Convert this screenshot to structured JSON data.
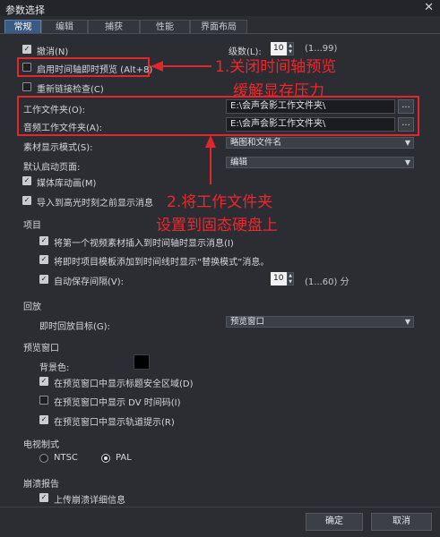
{
  "window": {
    "title": "参数选择"
  },
  "tabs": [
    {
      "label": "常规",
      "active": true
    },
    {
      "label": "编辑"
    },
    {
      "label": "捕获"
    },
    {
      "label": "性能"
    },
    {
      "label": "界面布局"
    }
  ],
  "general": {
    "undo": {
      "label": "撤消(N)",
      "checked": true
    },
    "levels": {
      "label": "级数(L):",
      "value": "10",
      "range": "(1...99)"
    },
    "instant_preview": {
      "label": "启用时间轴即时预览 (Alt+8)",
      "checked": false
    },
    "relink_check": {
      "label": "重新链接检查(C)",
      "checked": false
    },
    "work_folder": {
      "label": "工作文件夹(O):",
      "value": "E:\\会声会影工作文件夹\\",
      "browse": "..."
    },
    "audio_work_folder": {
      "label": "音频工作文件夹(A):",
      "value": "E:\\会声会影工作文件夹\\",
      "browse": "..."
    },
    "clip_display_mode": {
      "label": "素材显示模式(S):",
      "value": "略图和文件名"
    },
    "default_start_page": {
      "label": "默认启动页面:",
      "value": "编辑"
    },
    "media_library_animation": {
      "label": "媒体库动画(M)",
      "checked": true
    },
    "import_highlight": {
      "label": "导入到高光时刻之前显示消息",
      "checked": true
    }
  },
  "project": {
    "title": "项目",
    "first_clip_msg": {
      "label": "将第一个视频素材插入到时间轴时显示消息(I)",
      "checked": true
    },
    "replace_mode_msg": {
      "label": "将即时项目模板添加到时间线时显示“替换模式”消息。",
      "checked": true
    },
    "autosave": {
      "label": "自动保存间隔(V):",
      "checked": true,
      "value": "10",
      "range": "(1...60) 分"
    }
  },
  "playback": {
    "title": "回放",
    "target": {
      "label": "即时回放目标(G):",
      "value": "预览窗口"
    }
  },
  "preview_window": {
    "title": "预览窗口",
    "bg_color": {
      "label": "背景色:",
      "color": "#000000"
    },
    "title_safe": {
      "label": "在预览窗口中显示标题安全区域(D)",
      "checked": true
    },
    "dv_timecode": {
      "label": "在预览窗口中显示 DV 时间码(I)",
      "checked": false
    },
    "track_hints": {
      "label": "在预览窗口中显示轨道提示(R)",
      "checked": true
    }
  },
  "tv_format": {
    "title": "电视制式",
    "ntsc": {
      "label": "NTSC",
      "selected": false
    },
    "pal": {
      "label": "PAL",
      "selected": true
    }
  },
  "crash_report": {
    "title": "崩溃报告",
    "upload": {
      "label": "上传崩溃详细信息",
      "checked": true
    }
  },
  "buttons": {
    "ok": "确定",
    "cancel": "取消"
  },
  "annotations": {
    "note1_line1": "1.关闭时间轴预览",
    "note1_line2": "缓解显存压力",
    "note2_line1": "2.将工作文件夹",
    "note2_line2": "设置到固态硬盘上",
    "color": "#e3262b"
  },
  "icons": {
    "close": "close-icon",
    "check": "checkmark-icon",
    "caret": "chevron-down-icon"
  }
}
